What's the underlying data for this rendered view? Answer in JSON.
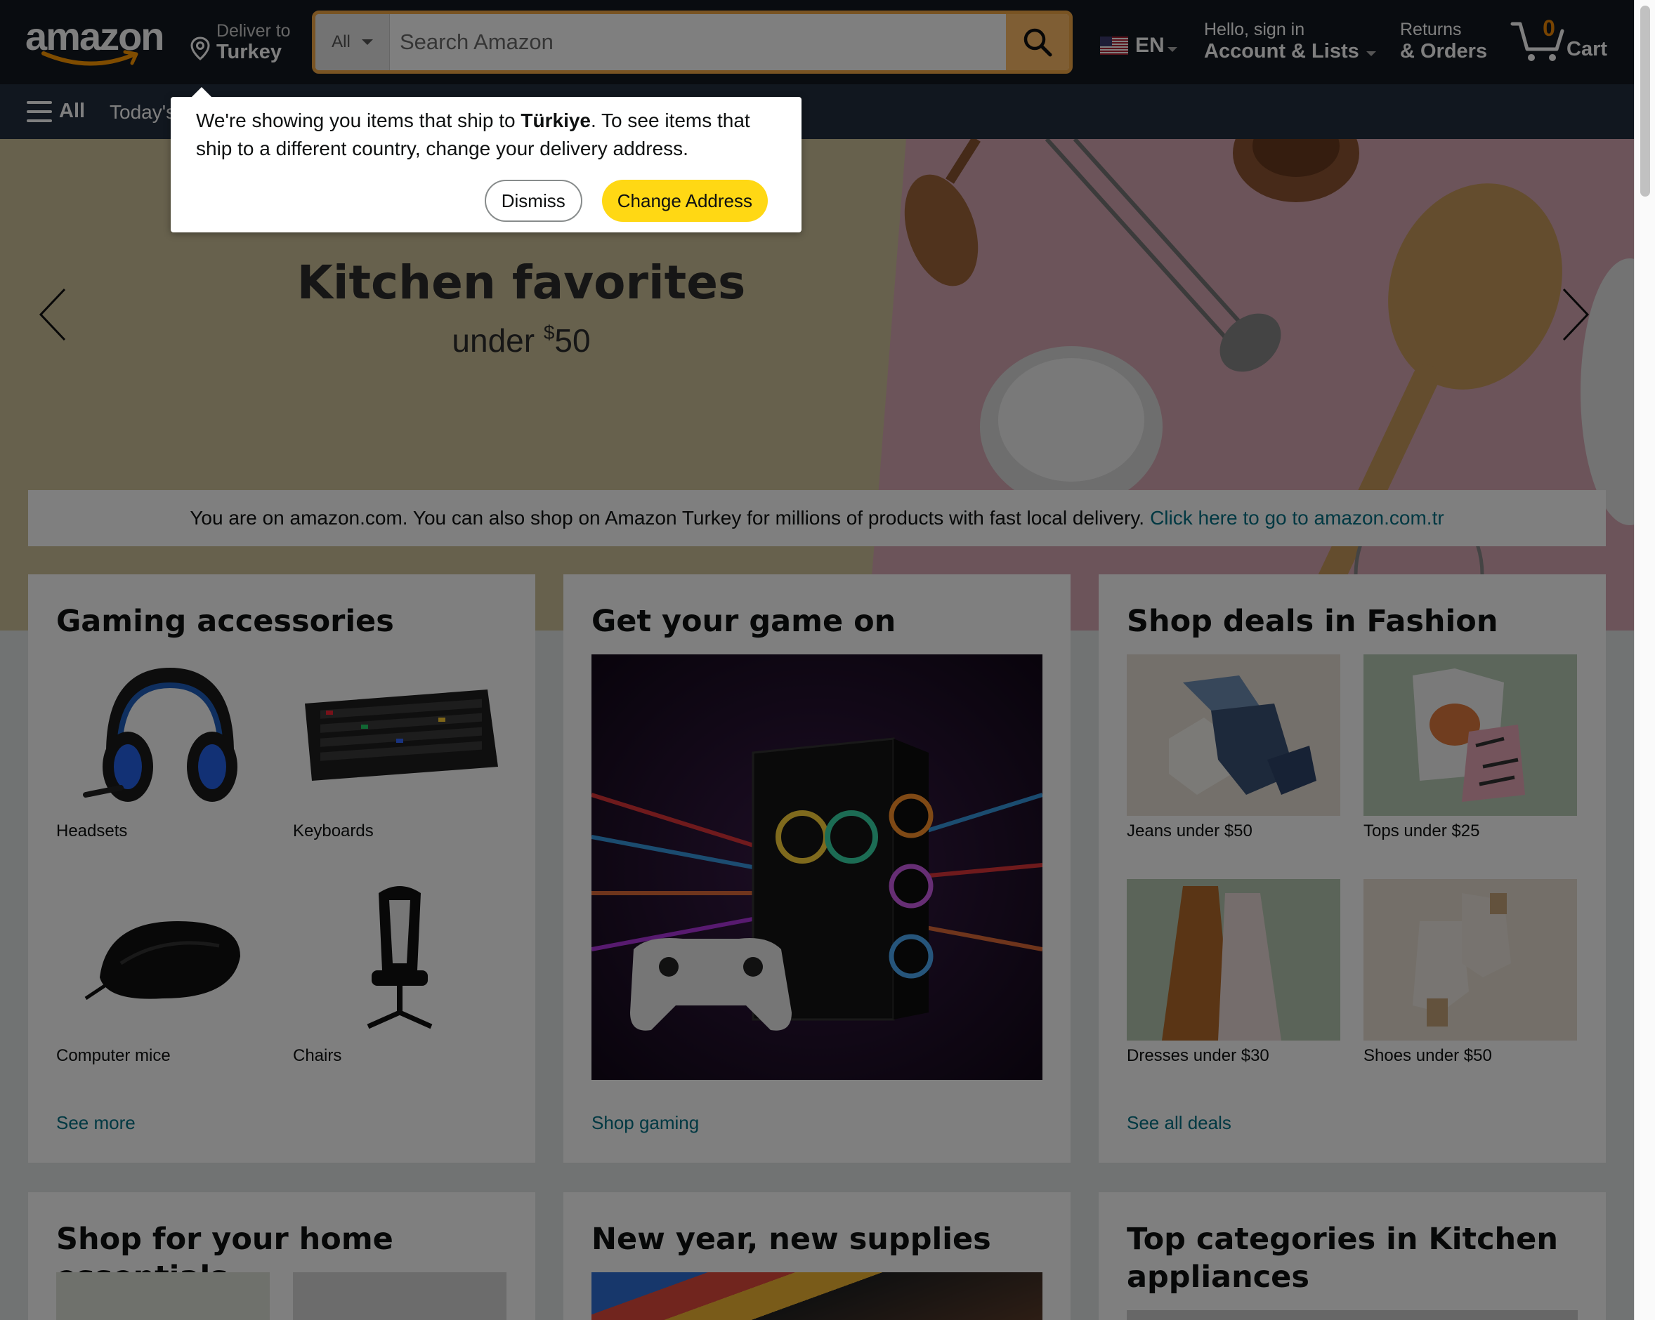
{
  "header": {
    "logo_text": "amazon",
    "deliver_line1": "Deliver to",
    "deliver_line2": "Turkey",
    "search": {
      "category": "All",
      "placeholder": "Search Amazon",
      "value": ""
    },
    "language": "EN",
    "account_line1": "Hello, sign in",
    "account_line2": "Account & Lists",
    "returns_line1": "Returns",
    "returns_line2": "& Orders",
    "cart_count": "0",
    "cart_label": "Cart"
  },
  "subnav": {
    "all_label": "All",
    "today_label": "Today's"
  },
  "popover": {
    "msg_part1": "We're showing you items that ship to ",
    "msg_bold": "Türkiye",
    "msg_part2": ". To see items that ship to a different country, change your delivery address.",
    "dismiss_label": "Dismiss",
    "change_label": "Change Address"
  },
  "hero": {
    "title": "Kitchen favorites",
    "subtitle_prefix": "under ",
    "subtitle_currency": "$",
    "subtitle_amount": "50"
  },
  "info_bar": {
    "text": "You are on amazon.com. You can also shop on Amazon Turkey for millions of products with fast local delivery.",
    "link": "Click here to go to amazon.com.tr"
  },
  "cards": {
    "gaming": {
      "title": "Gaming accessories",
      "items": [
        {
          "label": "Headsets"
        },
        {
          "label": "Keyboards"
        },
        {
          "label": "Computer mice"
        },
        {
          "label": "Chairs"
        }
      ],
      "link": "See more"
    },
    "game_on": {
      "title": "Get your game on",
      "link": "Shop gaming"
    },
    "fashion": {
      "title": "Shop deals in Fashion",
      "items": [
        {
          "label": "Jeans under $50"
        },
        {
          "label": "Tops under $25"
        },
        {
          "label": "Dresses under $30"
        },
        {
          "label": "Shoes under $50"
        }
      ],
      "link": "See all deals"
    },
    "home": {
      "title": "Shop for your home essentials"
    },
    "supplies": {
      "title": "New year, new supplies"
    },
    "kitchen": {
      "title": "Top categories in Kitchen appliances"
    }
  },
  "colors": {
    "nav_belt": "#131921",
    "nav_main": "#232f3e",
    "search_accent": "#febd69",
    "cart_count": "#f08804",
    "link": "#007185",
    "change_button": "#ffd814"
  },
  "icons": {
    "search": "magnifier-icon",
    "location": "location-pin-icon",
    "cart": "cart-icon",
    "flag": "us-flag-icon",
    "menu": "hamburger-icon",
    "prev": "chevron-left-icon",
    "next": "chevron-right-icon"
  }
}
